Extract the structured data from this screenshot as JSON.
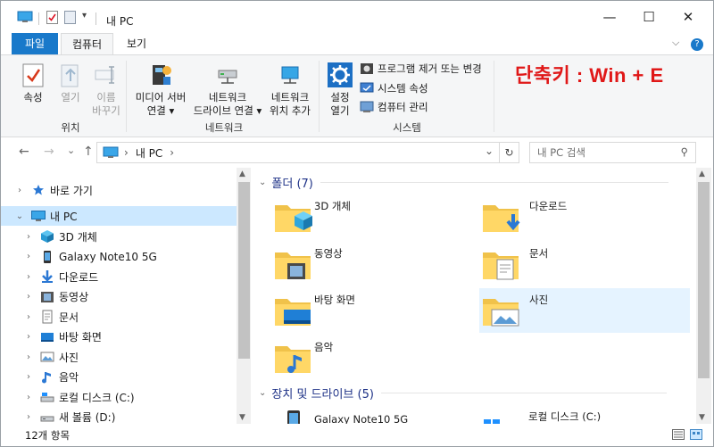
{
  "titlebar": {
    "title": "내 PC",
    "minimize": "—",
    "maximize": "☐",
    "close": "✕"
  },
  "tabs": {
    "file": "파일",
    "computer": "컴퓨터",
    "view": "보기",
    "chevron": "⌵",
    "help": "?"
  },
  "ribbon": {
    "location": {
      "properties": "속성",
      "open": "열기",
      "rename_line1": "이름",
      "rename_line2": "바꾸기",
      "group": "위치"
    },
    "network": {
      "media_line1": "미디어 서버",
      "media_line2": "연결 ▾",
      "map_line1": "네트워크",
      "map_line2": "드라이브 연결 ▾",
      "addloc_line1": "네트워크",
      "addloc_line2": "위치 추가",
      "group": "네트워크"
    },
    "system": {
      "settings_line1": "설정",
      "settings_line2": "열기",
      "uninstall": "프로그램 제거 또는 변경",
      "sysprops": "시스템 속성",
      "manage": "컴퓨터 관리",
      "group": "시스템"
    },
    "shortcut_text": "단축키 : Win + E"
  },
  "address": {
    "back": "←",
    "forward": "→",
    "recent": "⌄",
    "up": "↑",
    "sep1": "›",
    "path": "내 PC",
    "sep2": "›",
    "dropdown": "⌄",
    "refresh": "↻",
    "search_placeholder": "내 PC 검색",
    "search_icon": "⚲"
  },
  "nav": {
    "quick_access": "바로 가기",
    "this_pc": "내 PC",
    "items": [
      {
        "label": "3D 개체",
        "icon": "3d-objects-icon"
      },
      {
        "label": "Galaxy Note10 5G",
        "icon": "phone-icon"
      },
      {
        "label": "다운로드",
        "icon": "download-icon"
      },
      {
        "label": "동영상",
        "icon": "videos-icon"
      },
      {
        "label": "문서",
        "icon": "documents-icon"
      },
      {
        "label": "바탕 화면",
        "icon": "desktop-icon"
      },
      {
        "label": "사진",
        "icon": "pictures-icon"
      },
      {
        "label": "음악",
        "icon": "music-icon"
      },
      {
        "label": "로컬 디스크 (C:)",
        "icon": "disk-c-icon"
      },
      {
        "label": "새 볼륨 (D:)",
        "icon": "disk-d-icon"
      }
    ]
  },
  "content": {
    "folders_header": "폴더 (7)",
    "folders": [
      {
        "label": "3D 개체"
      },
      {
        "label": "다운로드"
      },
      {
        "label": "동영상"
      },
      {
        "label": "문서"
      },
      {
        "label": "바탕 화면"
      },
      {
        "label": "사진"
      },
      {
        "label": "음악"
      }
    ],
    "devices_header": "장치 및 드라이브 (5)",
    "devices": [
      {
        "label": "Galaxy Note10 5G"
      },
      {
        "label": "로컬 디스크 (C:)"
      }
    ]
  },
  "status": {
    "count": "12개 항목"
  },
  "colors": {
    "accent": "#1979ca",
    "selection": "#cce8ff",
    "shortcut": "#e01818",
    "header": "#1e3287"
  }
}
